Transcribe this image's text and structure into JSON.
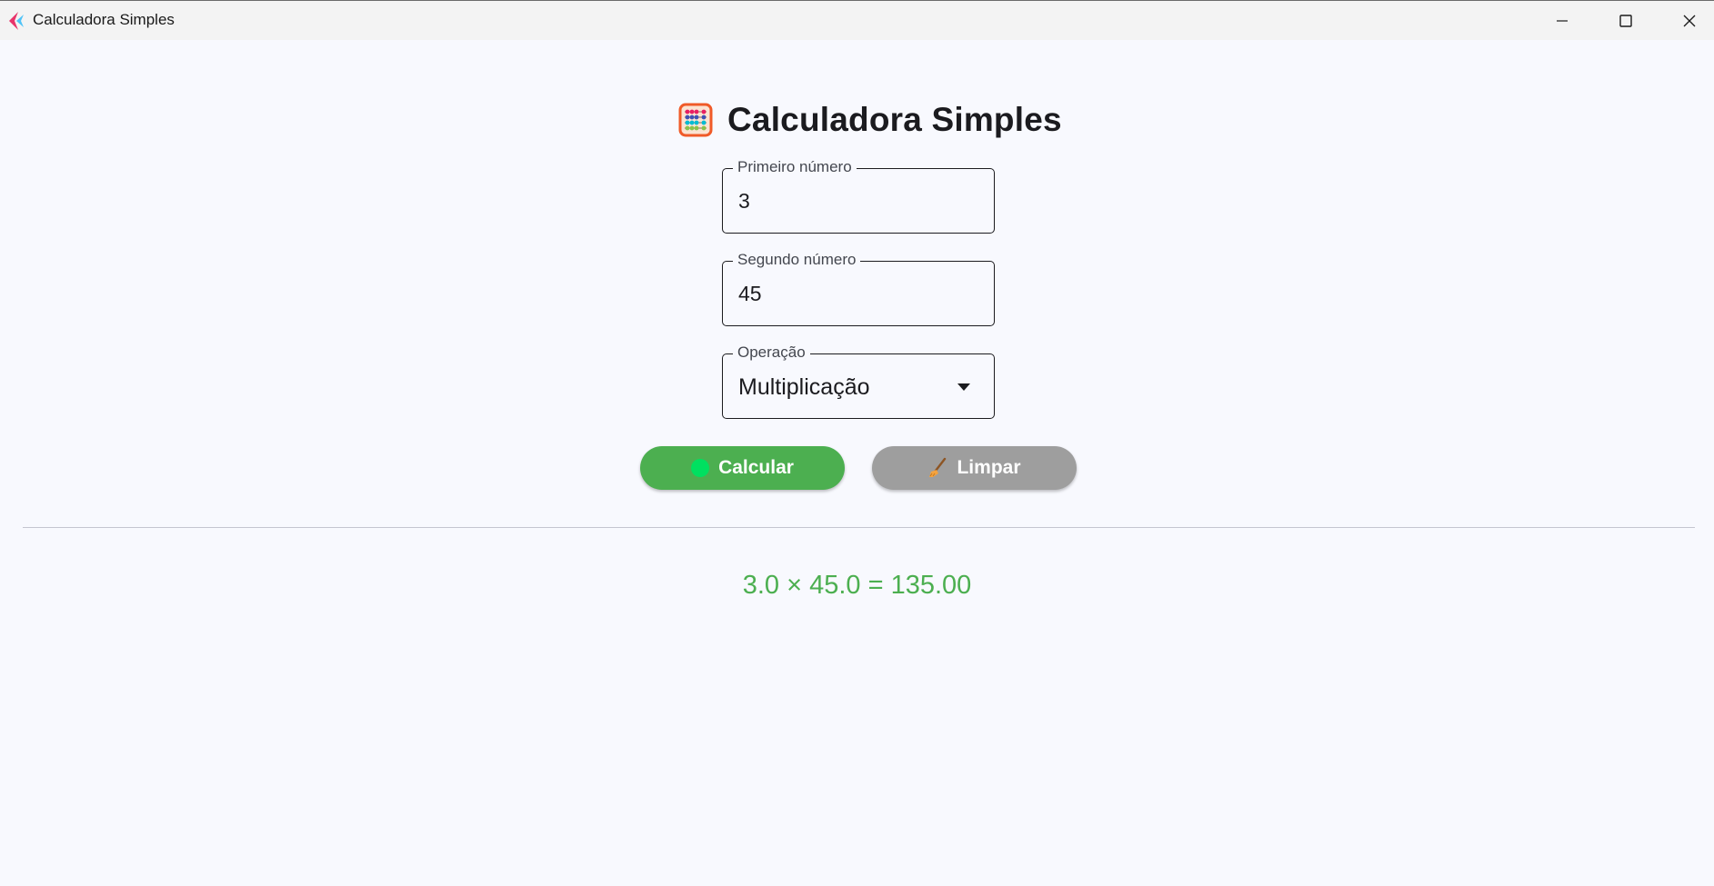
{
  "window": {
    "title": "Calculadora Simples",
    "controls": {
      "minimize": "minimize-icon",
      "maximize": "maximize-icon",
      "close": "close-icon"
    }
  },
  "main": {
    "heading": "Calculadora Simples",
    "heading_icon": "abacus-icon",
    "fields": {
      "first": {
        "label": "Primeiro número",
        "value": "3"
      },
      "second": {
        "label": "Segundo número",
        "value": "45"
      },
      "operation": {
        "label": "Operação",
        "value": "Multiplicação"
      }
    },
    "buttons": {
      "calculate": {
        "label": "Calcular",
        "icon": "green-circle-icon",
        "color": "#4caf50"
      },
      "clear": {
        "label": "Limpar",
        "icon": "broom-icon",
        "color": "#9e9e9e"
      }
    },
    "result": {
      "text": "3.0 × 45.0 = 135.00",
      "color": "#4caf50"
    }
  }
}
